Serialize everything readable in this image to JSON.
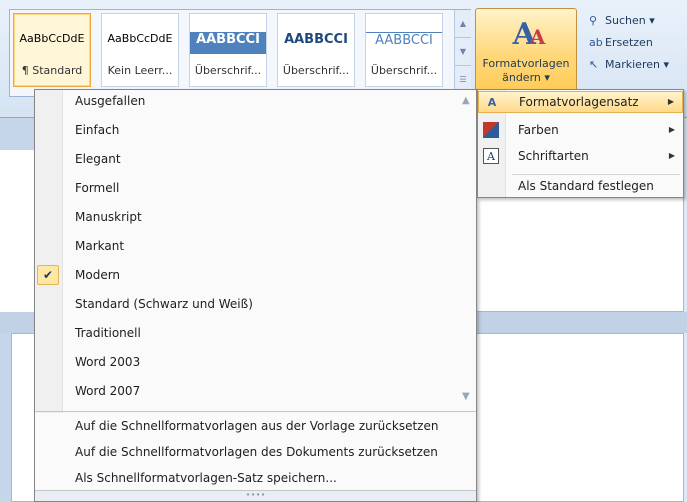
{
  "ribbon": {
    "styles": [
      {
        "sample": "AaBbCcDdE",
        "name": "¶ Standard",
        "selected": true
      },
      {
        "sample": "AaBbCcDdE",
        "name": "Kein Leerr...",
        "selected": false
      },
      {
        "sample": "AABBCCI",
        "name": "Überschrif...",
        "selected": false
      },
      {
        "sample": "AABBCCI",
        "name": "Überschrif...",
        "selected": false
      },
      {
        "sample": "AABBCCI",
        "name": "Überschrif...",
        "selected": false
      }
    ],
    "change_styles": {
      "line1": "Formatvorlagen",
      "line2": "ändern ▾"
    },
    "editing": [
      {
        "icon": "binoculars-icon",
        "glyph": "🔍",
        "label": "Suchen ▾"
      },
      {
        "icon": "replace-icon",
        "glyph": "ab",
        "label": "Ersetzen"
      },
      {
        "icon": "select-cursor-icon",
        "glyph": "↖",
        "label": "Markieren ▾"
      }
    ]
  },
  "menu": {
    "items": [
      {
        "label": "Ausgefallen",
        "checked": false
      },
      {
        "label": "Einfach",
        "checked": false
      },
      {
        "label": "Elegant",
        "checked": false
      },
      {
        "label": "Formell",
        "checked": false
      },
      {
        "label": "Manuskript",
        "checked": false
      },
      {
        "label": "Markant",
        "checked": false
      },
      {
        "label": "Modern",
        "checked": true
      },
      {
        "label": "Standard (Schwarz und Weiß)",
        "checked": false
      },
      {
        "label": "Traditionell",
        "checked": false
      },
      {
        "label": "Word 2003",
        "checked": false
      },
      {
        "label": "Word 2007",
        "checked": false
      }
    ],
    "actions": [
      "Auf die Schnellformatvorlagen aus der Vorlage zurücksetzen",
      "Auf die Schnellformatvorlagen des Dokuments zurücksetzen",
      "Als Schnellformatvorlagen-Satz speichern..."
    ],
    "grip": "∙∙∙∙"
  },
  "submenu": {
    "items": [
      {
        "label": "Formatvorlagensatz",
        "has_arrow": true,
        "active": true,
        "icon": "style-set-icon"
      },
      {
        "label": "Farben",
        "has_arrow": true,
        "active": false,
        "icon": "colors-icon"
      },
      {
        "label": "Schriftarten",
        "has_arrow": true,
        "active": false,
        "icon": "fonts-icon"
      },
      {
        "label": "Als Standard festlegen",
        "has_arrow": false,
        "active": false,
        "icon": ""
      }
    ]
  }
}
